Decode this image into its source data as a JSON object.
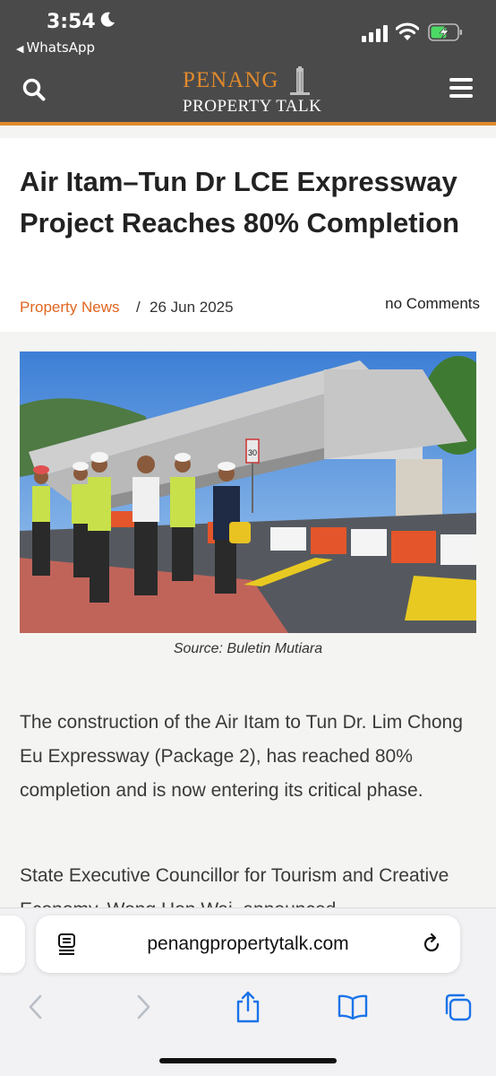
{
  "status_bar": {
    "time": "3:54",
    "back_app": "WhatsApp"
  },
  "header": {
    "logo_line1": "PENANG",
    "logo_line2": "PROPERTY TALK",
    "accent_color": "#e08a2c"
  },
  "article": {
    "title": "Air Itam–Tun Dr LCE Expressway Project Reaches 80% Completion",
    "category": "Property News",
    "separator": "/",
    "date": "26 Jun 2025",
    "comments": "no Comments",
    "image_caption": "Source: Buletin Mutiara",
    "speed_sign": "30",
    "paragraphs": [
      "The construction of the Air Itam to Tun Dr. Lim Chong Eu Expressway (Package 2), has reached 80% completion and is now entering its critical phase.",
      "State Executive Councillor for Tourism and Creative Economy, Wong Hon Wai, announced"
    ]
  },
  "browser": {
    "url": "penangpropertytalk.com",
    "icons": [
      "page-menu-icon",
      "reload-icon",
      "back-icon",
      "forward-icon",
      "share-icon",
      "bookmarks-icon",
      "tabs-icon"
    ]
  }
}
